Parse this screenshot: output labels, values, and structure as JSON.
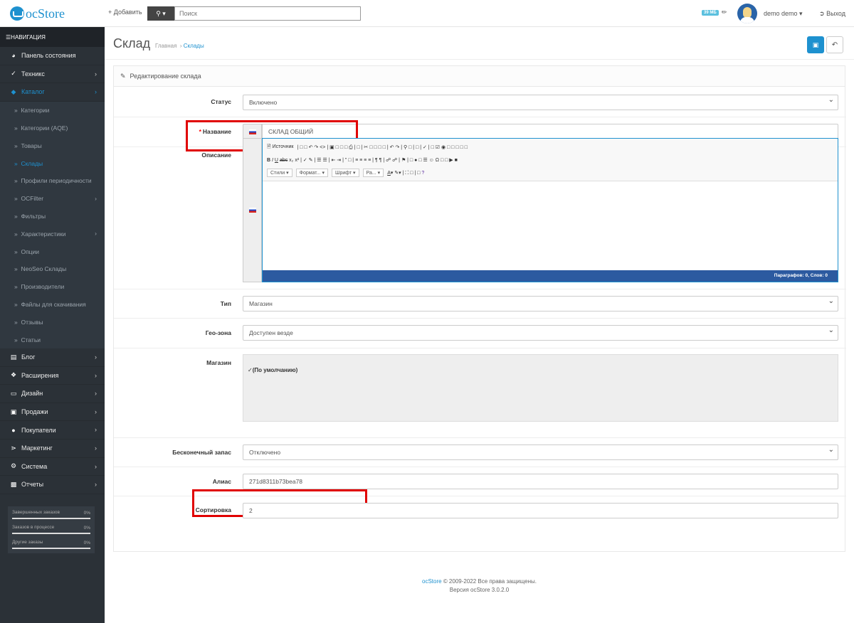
{
  "header": {
    "logo": "ocStore",
    "add_label": "+ Добавить",
    "search_placeholder": "Поиск",
    "memory_badge": "39 МБ",
    "user_name": "demo demo",
    "logout_label": "Выход"
  },
  "sidebar": {
    "nav_title": "НАВИГАЦИЯ",
    "items": [
      {
        "label": "Панель состояния",
        "icon": "dashboard-icon"
      },
      {
        "label": "Техникс",
        "icon": "magic-icon"
      },
      {
        "label": "Каталог",
        "icon": "tags-icon"
      }
    ],
    "catalog_sub": [
      {
        "label": "Категории"
      },
      {
        "label": "Категории (AQE)"
      },
      {
        "label": "Товары"
      },
      {
        "label": "Склады"
      },
      {
        "label": "Профили периодичности"
      },
      {
        "label": "OCFilter"
      },
      {
        "label": "Фильтры"
      },
      {
        "label": "Характеристики"
      },
      {
        "label": "Опции"
      },
      {
        "label": "NeoSeo Склады"
      },
      {
        "label": "Производители"
      },
      {
        "label": "Файлы для скачивания"
      },
      {
        "label": "Отзывы"
      },
      {
        "label": "Статьи"
      }
    ],
    "items2": [
      {
        "label": "Блог",
        "icon": "book-icon"
      },
      {
        "label": "Расширения",
        "icon": "puzzle-icon"
      },
      {
        "label": "Дизайн",
        "icon": "monitor-icon"
      },
      {
        "label": "Продажи",
        "icon": "cart-icon"
      },
      {
        "label": "Покупатели",
        "icon": "user-icon"
      },
      {
        "label": "Маркетинг",
        "icon": "share-icon"
      },
      {
        "label": "Система",
        "icon": "cog-icon"
      },
      {
        "label": "Отчеты",
        "icon": "bar-chart-icon"
      }
    ],
    "stats": [
      {
        "label": "Завершенных заказов",
        "value": "0%"
      },
      {
        "label": "Заказов в процессе",
        "value": "0%"
      },
      {
        "label": "Другие заказы",
        "value": "0%"
      }
    ]
  },
  "page": {
    "title": "Склад",
    "breadcrumb_home": "Главная",
    "breadcrumb_current": "Склады",
    "panel_title": "Редактирование склада"
  },
  "form": {
    "status_label": "Статус",
    "status_value": "Включено",
    "name_label": "Название",
    "name_value": "СКЛАД ОБЩИЙ",
    "description_label": "Описание",
    "editor_source": "Источник",
    "editor_styles": "Стили",
    "editor_format": "Формат...",
    "editor_font": "Шрифт",
    "editor_size": "Ра...",
    "editor_footer": "Параграфов: 0, Слов: 0",
    "type_label": "Тип",
    "type_value": "Магазин",
    "geo_label": "Гео-зона",
    "geo_value": "Доступен везде",
    "store_label": "Магазин",
    "store_value": "(По умолчанию)",
    "infinite_label": "Бесконечный запас",
    "infinite_value": "Отключено",
    "alias_label": "Алиас",
    "alias_value": "271d8311b73bea78",
    "sort_label": "Сортировка",
    "sort_value": "2"
  },
  "footer": {
    "brand": "ocStore",
    "copyright": "© 2009-2022 Все права защищены.",
    "version": "Версия ocStore 3.0.2.0"
  },
  "colors": {
    "accent": "#1e91cf",
    "sidebar": "#2b3137",
    "highlight": "#e00000"
  }
}
